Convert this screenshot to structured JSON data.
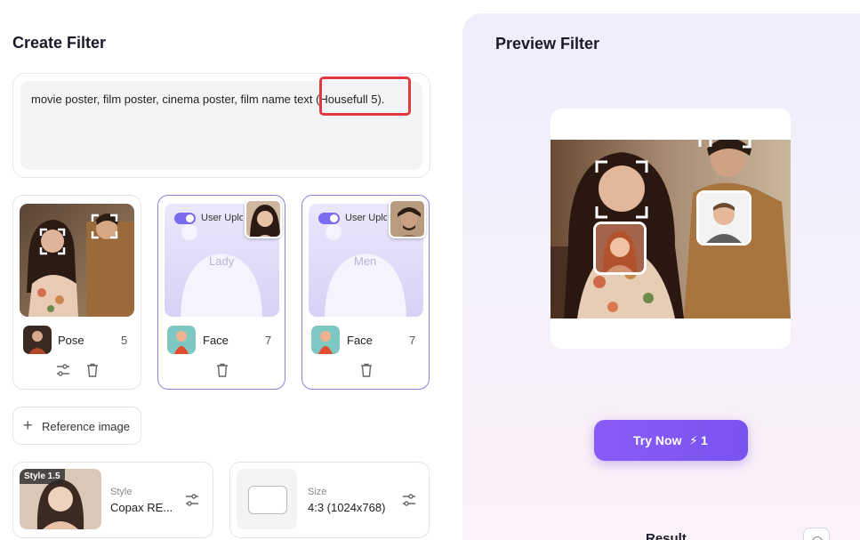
{
  "create_filter": {
    "title": "Create Filter",
    "prompt": "movie poster, film poster, cinema poster, film name text (Housefull 5)."
  },
  "cards": [
    {
      "label": "Pose",
      "count": "5"
    },
    {
      "label": "Face",
      "count": "7",
      "toggle_label": "User Uplo",
      "placeholder": "Lady"
    },
    {
      "label": "Face",
      "count": "7",
      "toggle_label": "User Uplo",
      "placeholder": "Men"
    }
  ],
  "reference_button": "Reference image",
  "style": {
    "badge": "Style 1.5",
    "caption": "Style",
    "value": "Copax RE..."
  },
  "size": {
    "caption": "Size",
    "value": "4:3 (1024x768)"
  },
  "preview": {
    "title": "Preview Filter",
    "try_label": "Try Now",
    "credit": "1",
    "result_label": "Result"
  },
  "colors": {
    "accent": "#7b6bf0",
    "highlight": "#e0393e"
  }
}
